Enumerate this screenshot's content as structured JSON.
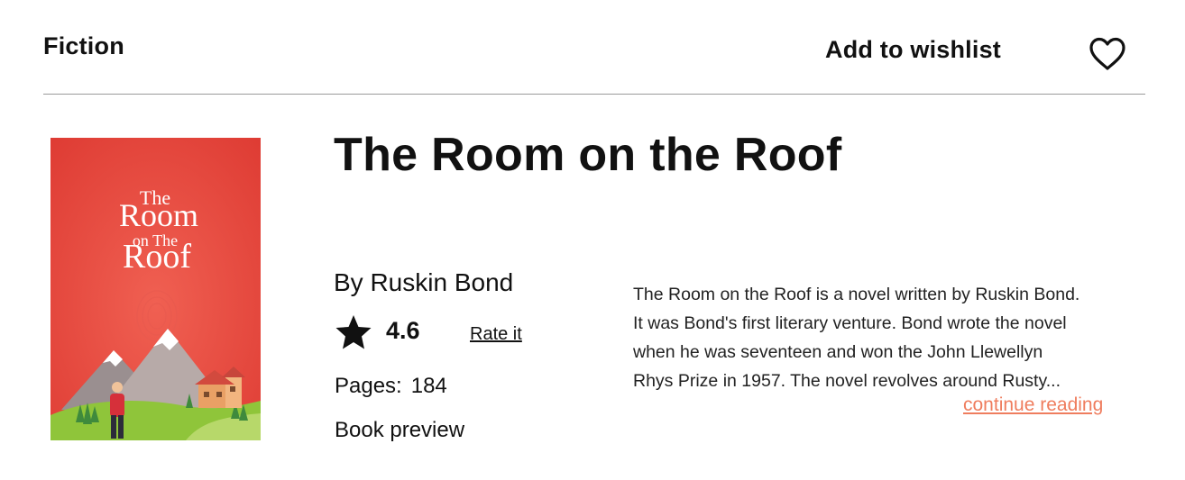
{
  "header": {
    "category": "Fiction",
    "wishlist_label": "Add to wishlist",
    "wishlist_icon": "heart-outline-icon"
  },
  "book": {
    "title": "The Room on the Roof",
    "author": "By Ruskin Bond",
    "rating": "4.6",
    "rating_icon": "star-icon",
    "rate_label": "Rate it",
    "pages_label": "Pages:",
    "pages_value": "184",
    "preview_label": "Book preview",
    "description_lines": [
      "The Room on the Roof is a novel written by Ruskin Bond.",
      "It was Bond's first literary venture. Bond wrote the novel",
      "when he was seventeen and won the John Llewellyn",
      "Rhys Prize in 1957. The novel revolves around Rusty..."
    ],
    "continue_label": "continue reading",
    "cover": {
      "title_line1": "The",
      "title_line2": "Room",
      "title_line3": "on The",
      "title_line4": "Roof",
      "background": "#e2463c"
    }
  },
  "colors": {
    "accent": "#ef7d5e",
    "divider": "#9a9a9a",
    "text": "#111111"
  }
}
